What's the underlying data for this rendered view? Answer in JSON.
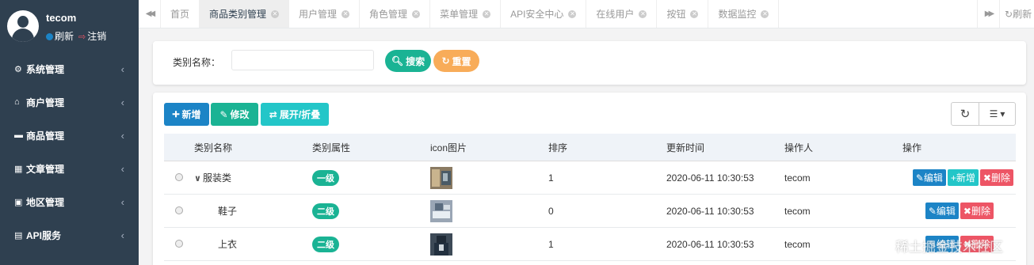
{
  "sidebar": {
    "username": "tecom",
    "refresh_label": "刷新",
    "logout_label": "注销",
    "items": [
      {
        "label": "系统管理",
        "icon": "gear-icon"
      },
      {
        "label": "商户管理",
        "icon": "bank-icon"
      },
      {
        "label": "商品管理",
        "icon": "cup-icon"
      },
      {
        "label": "文章管理",
        "icon": "calendar-icon"
      },
      {
        "label": "地区管理",
        "icon": "car-icon"
      },
      {
        "label": "API服务",
        "icon": "server-icon"
      }
    ]
  },
  "tabs": [
    "首页",
    "商品类别管理",
    "用户管理",
    "角色管理",
    "菜单管理",
    "API安全中心",
    "在线用户",
    "按钮",
    "数据监控"
  ],
  "active_tab_index": 1,
  "tabs_refresh_label": "刷新",
  "search": {
    "label": "类别名称：",
    "value": "",
    "search_label": "搜索",
    "reset_label": "重置"
  },
  "toolbar": {
    "add_label": "新增",
    "edit_label": "修改",
    "toggle_label": "展开/折叠"
  },
  "table": {
    "headers": [
      "类别名称",
      "类别属性",
      "icon图片",
      "排序",
      "更新时间",
      "操作人",
      "操作"
    ],
    "rows": [
      {
        "name": "服装类",
        "level": "一级",
        "sort": "1",
        "time": "2020-06-11 10:30:53",
        "operator": "tecom",
        "actions": [
          "编辑",
          "新增",
          "删除"
        ],
        "expanded": true
      },
      {
        "name": "鞋子",
        "level": "二级",
        "sort": "0",
        "time": "2020-06-11 10:30:53",
        "operator": "tecom",
        "actions": [
          "编辑",
          "删除"
        ],
        "expanded": false
      },
      {
        "name": "上衣",
        "level": "二级",
        "sort": "1",
        "time": "2020-06-11 10:30:53",
        "operator": "tecom",
        "actions": [
          "编辑",
          "删除"
        ],
        "expanded": false
      }
    ]
  },
  "watermark": "稀土掘金技术社区",
  "colors": {
    "sidebar": "#2f4050",
    "primary": "#1c84c6",
    "success": "#1ab394",
    "warning": "#f8ac59",
    "info": "#23c6c8",
    "danger": "#ed5565"
  }
}
